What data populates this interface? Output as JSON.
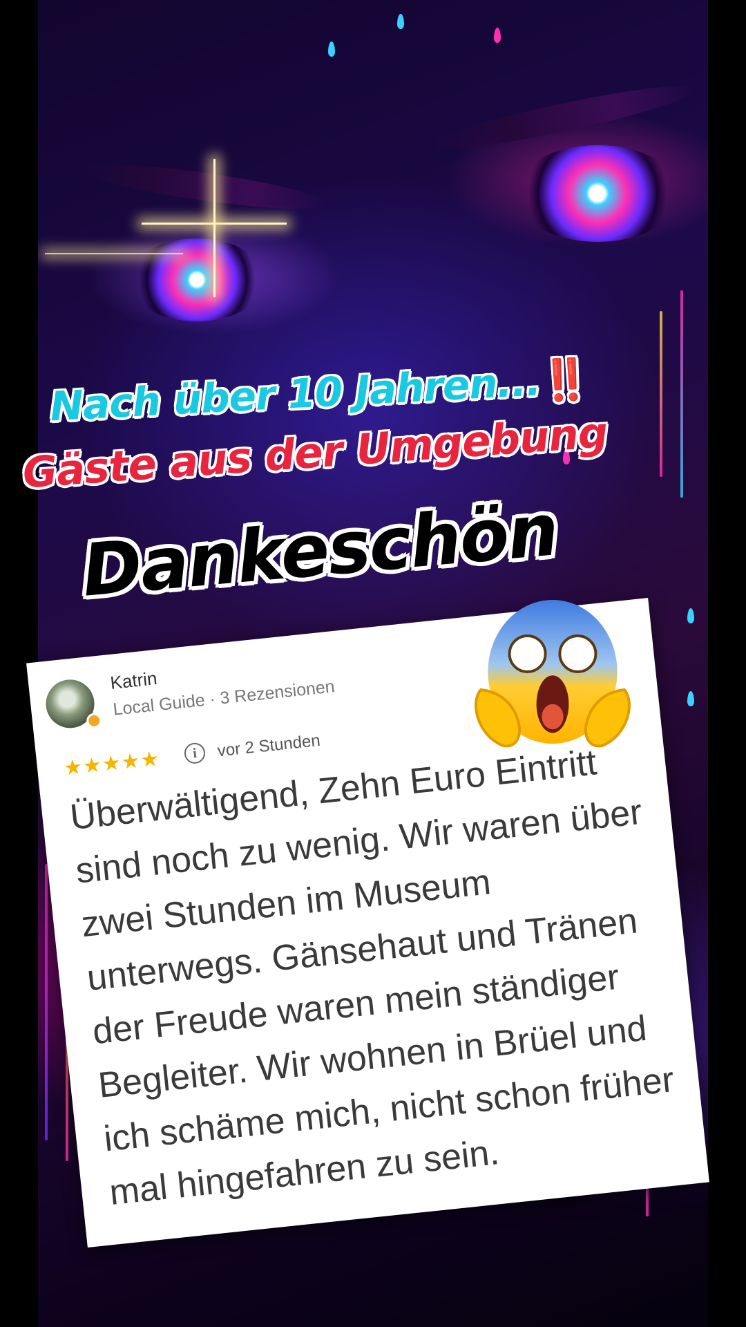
{
  "headline": {
    "line1": "Nach über 10 Jahren...",
    "line1_emoji": "‼️",
    "line2": "Gäste aus der Umgebung",
    "line3": "Dankeschön"
  },
  "review": {
    "reviewer_name": "Katrin",
    "reviewer_meta": "Local Guide · 3 Rezensionen",
    "rating": 5,
    "stars": "★★★★★",
    "time": "vor 2 Stunden",
    "text": "Überwältigend, Zehn Euro Eintritt sind noch zu wenig. Wir waren über zwei Stunden im Museum unterwegs. Gänsehaut und Tränen der Freude waren mein ständiger Begleiter. Wir wohnen in Brüel und ich schäme mich, nicht schon früher mal hingefahren zu sein."
  },
  "emoji_icon": "face-screaming-in-fear-icon",
  "colors": {
    "line1": "#19c9e2",
    "line2": "#e8253f",
    "line3": "#000000",
    "stars": "#f7b500"
  }
}
